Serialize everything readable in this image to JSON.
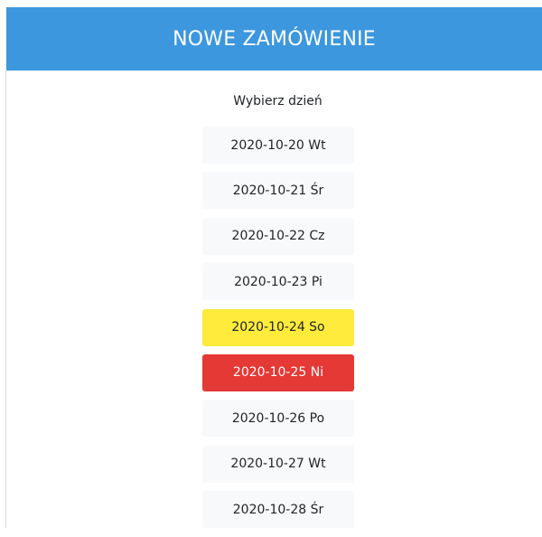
{
  "header": {
    "title": "NOWE ZAMÓWIENIE"
  },
  "section": {
    "label": "Wybierz dzień"
  },
  "days": [
    {
      "label": "2020-10-20 Wt",
      "status": "default"
    },
    {
      "label": "2020-10-21 Śr",
      "status": "default"
    },
    {
      "label": "2020-10-22 Cz",
      "status": "default"
    },
    {
      "label": "2020-10-23 Pi",
      "status": "default"
    },
    {
      "label": "2020-10-24 So",
      "status": "warning"
    },
    {
      "label": "2020-10-25 Ni",
      "status": "danger"
    },
    {
      "label": "2020-10-26 Po",
      "status": "default"
    },
    {
      "label": "2020-10-27 Wt",
      "status": "default"
    },
    {
      "label": "2020-10-28 Śr",
      "status": "default"
    }
  ],
  "colors": {
    "header_bg": "#3c97de",
    "default_bg": "#f8f9fa",
    "warning_bg": "#ffeb3b",
    "danger_bg": "#e53935"
  }
}
